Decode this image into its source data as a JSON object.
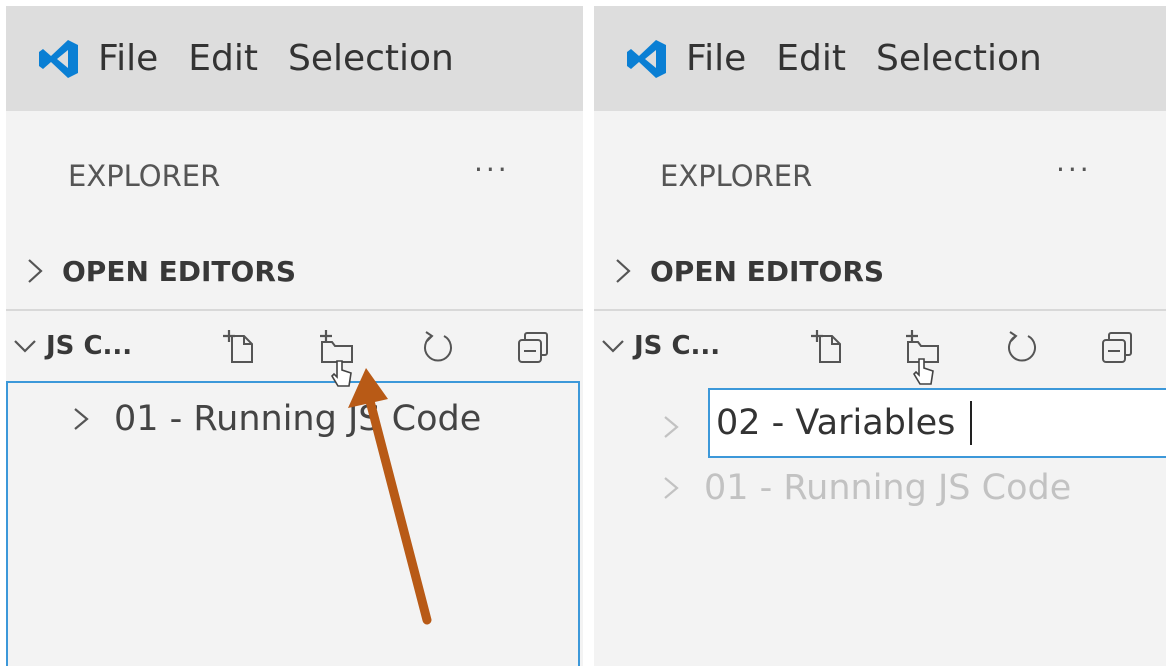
{
  "left": {
    "menu": [
      "File",
      "Edit",
      "Selection"
    ],
    "explorer_title": "EXPLORER",
    "more_actions": "···",
    "open_editors": "OPEN EDITORS",
    "folder_label": "JS C...",
    "tree_items": [
      "01 - Running JS Code"
    ]
  },
  "right": {
    "menu": [
      "File",
      "Edit",
      "Selection"
    ],
    "explorer_title": "EXPLORER",
    "more_actions": "···",
    "open_editors": "OPEN EDITORS",
    "folder_label": "JS C...",
    "rename_value": "02 - Variables",
    "tree_items": [
      "01 - Running JS Code"
    ]
  },
  "colors": {
    "accent_blue": "#3c98d9",
    "logo_blue": "#0a7fd4",
    "arrow": "#b85a16",
    "menubar_bg": "#dddddd",
    "sidebar_bg": "#f3f3f3"
  },
  "icons": [
    "vscode-logo",
    "chevron-right-icon",
    "chevron-down-icon",
    "new-file-icon",
    "new-folder-icon",
    "refresh-icon",
    "collapse-all-icon",
    "mouse-pointer-icon"
  ]
}
